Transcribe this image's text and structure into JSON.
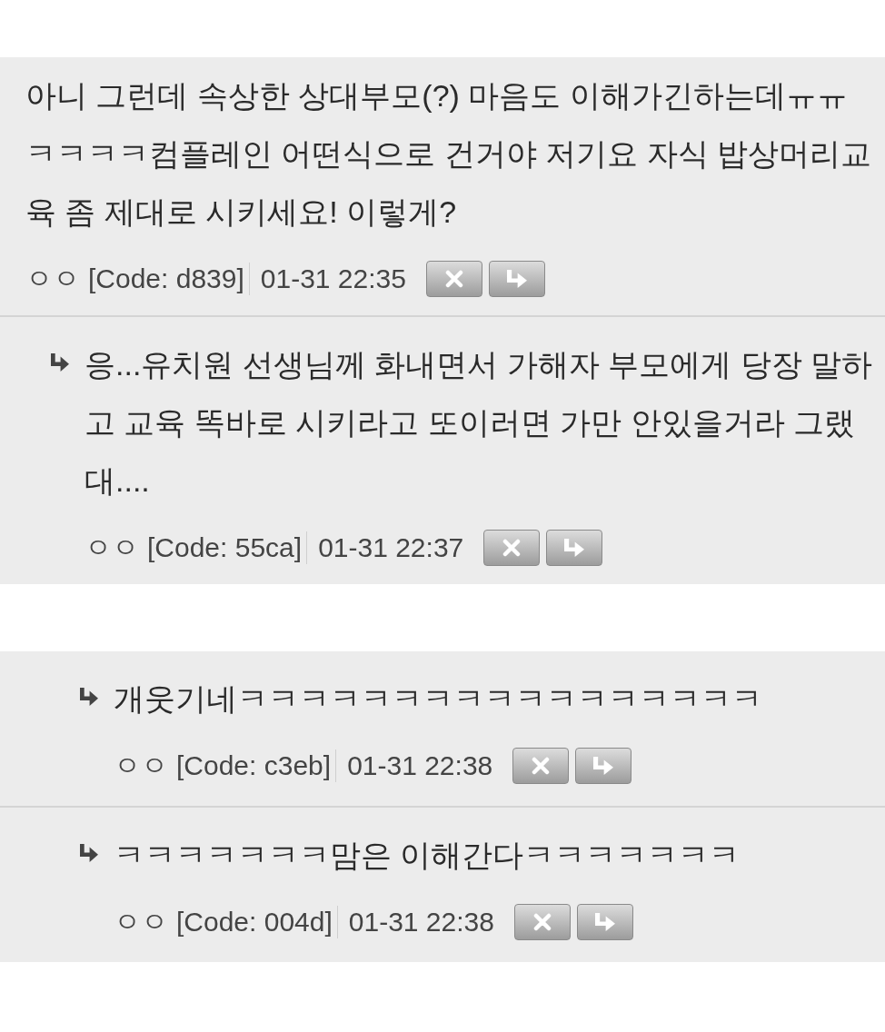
{
  "blocks": [
    {
      "kind": "thread",
      "comments": [
        {
          "kind": "comment",
          "text": "아니 그런데 속상한 상대부모(?) 마음도 이해가긴하는데ㅠㅠㅋㅋㅋㅋ컴플레인 어떤식으로 건거야 저기요 자식 밥상머리교육 좀 제대로 시키세요! 이렇게?",
          "author": "ㅇㅇ",
          "code": "[Code: d839]",
          "time": "01-31 22:35",
          "children": [
            {
              "kind": "reply",
              "text": "응...유치원 선생님께 화내면서 가해자 부모에게 당장 말하고 교육 똑바로 시키라고 또이러면 가만 안있을거라 그랬대....",
              "author": "ㅇㅇ",
              "code": "[Code: 55ca]",
              "time": "01-31 22:37"
            }
          ]
        }
      ]
    },
    {
      "kind": "nested",
      "comments": [
        {
          "kind": "reply",
          "text": "개웃기네ㅋㅋㅋㅋㅋㅋㅋㅋㅋㅋㅋㅋㅋㅋㅋㅋㅋ",
          "author": "ㅇㅇ",
          "code": "[Code: c3eb]",
          "time": "01-31 22:38"
        },
        {
          "kind": "reply",
          "text": "ㅋㅋㅋㅋㅋㅋㅋ맘은 이해간다ㅋㅋㅋㅋㅋㅋㅋ",
          "author": "ㅇㅇ",
          "code": "[Code: 004d]",
          "time": "01-31 22:38"
        }
      ]
    }
  ]
}
